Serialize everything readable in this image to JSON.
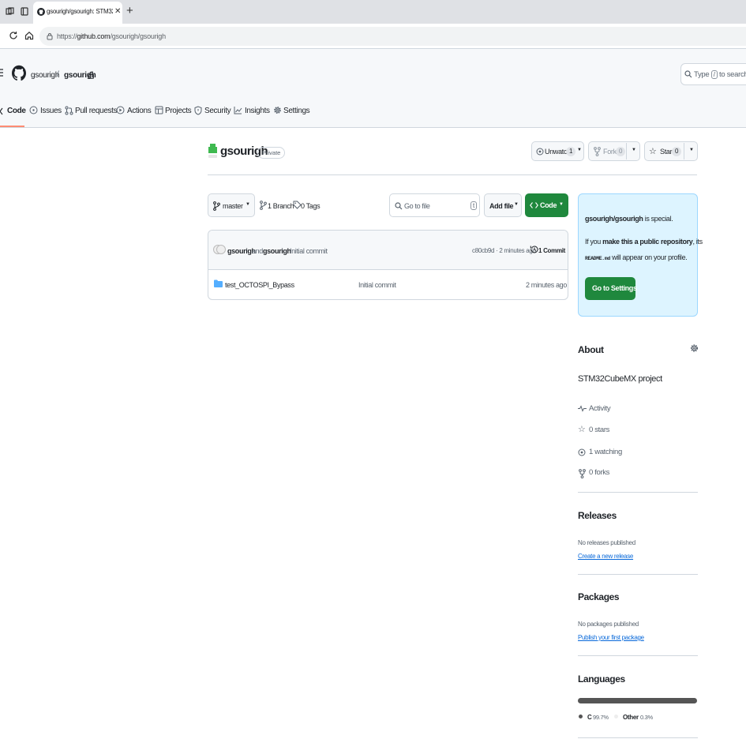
{
  "browser": {
    "tab_title": "gsourigh/gsourigh: STM32CubeMX",
    "url_prefix": "https://",
    "url_domain": "github.com",
    "url_path": "/gsourigh/gsourigh"
  },
  "header": {
    "owner": "gsourigh",
    "separator": "/",
    "repo": "gsourigh",
    "search_prefix": "Type",
    "search_key": "/",
    "search_suffix": "to search"
  },
  "nav": {
    "tabs": [
      {
        "label": "Code",
        "icon": "code-icon",
        "selected": true
      },
      {
        "label": "Issues",
        "icon": "issue-icon"
      },
      {
        "label": "Pull requests",
        "icon": "pull-request-icon"
      },
      {
        "label": "Actions",
        "icon": "play-icon"
      },
      {
        "label": "Projects",
        "icon": "table-icon"
      },
      {
        "label": "Security",
        "icon": "shield-icon"
      },
      {
        "label": "Insights",
        "icon": "graph-icon"
      },
      {
        "label": "Settings",
        "icon": "gear-icon"
      }
    ]
  },
  "repo": {
    "name": "gsourigh",
    "visibility": "Private",
    "unwatch_label": "Unwatch",
    "watch_count": "1",
    "fork_label": "Fork",
    "fork_count": "0",
    "star_label": "Star",
    "star_count": "0"
  },
  "toolbar": {
    "branch": "master",
    "branch_count": "1 Branch",
    "tag_count": "0 Tags",
    "go_to_file_placeholder": "Go to file",
    "go_to_file_key": "t",
    "add_file_label": "Add file",
    "code_label": "Code"
  },
  "commit": {
    "author1": "gsourigh",
    "and_text": "and",
    "author2": "gsourigh",
    "message": "Initial commit",
    "hash_time": "c80cb9d · 2 minutes ago",
    "commit_count": "1 Commit"
  },
  "files": [
    {
      "name": "test_OCTOSPI_Bypass",
      "icon": "folder-icon",
      "message": "Initial commit",
      "time": "2 minutes ago"
    }
  ],
  "special": {
    "repo_path": "gsourigh/gsourigh",
    "is_special": "is special.",
    "line2_pre": "If you",
    "line2_bold": "make this a public repository",
    "line2_post": ", its",
    "readme": "README.md",
    "line3_post": "will appear on your profile.",
    "button": "Go to Settings"
  },
  "about": {
    "heading": "About",
    "description": "STM32CubeMX project",
    "items": [
      {
        "label": "Activity",
        "icon": "pulse-icon"
      },
      {
        "label": "0 stars",
        "icon": "star-icon"
      },
      {
        "label": "1 watching",
        "icon": "eye-icon"
      },
      {
        "label": "0 forks",
        "icon": "fork-icon"
      }
    ]
  },
  "releases": {
    "heading": "Releases",
    "none_text": "No releases published",
    "link": "Create a new release"
  },
  "packages": {
    "heading": "Packages",
    "none_text": "No packages published",
    "link": "Publish your first package"
  },
  "languages": {
    "heading": "Languages",
    "items": [
      {
        "name": "C",
        "percent": "99.7%",
        "value": 99.7,
        "color": "#555555"
      },
      {
        "name": "Other",
        "percent": "0.3%",
        "value": 0.3,
        "color": "#ededed"
      }
    ]
  },
  "colors": {
    "accent": "#0969da",
    "primary_button": "#1f883d",
    "nav_underline": "#fd8c73"
  }
}
